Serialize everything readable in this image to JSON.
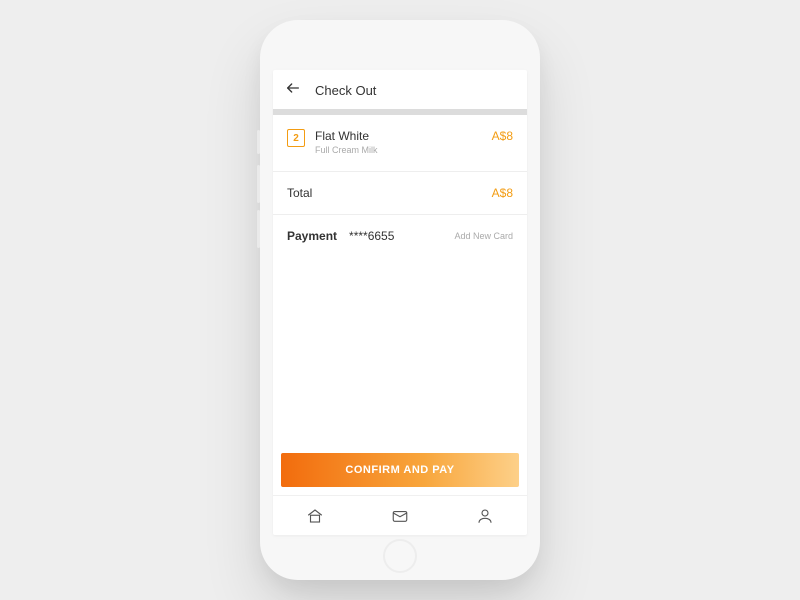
{
  "header": {
    "title": "Check Out"
  },
  "item": {
    "quantity": "2",
    "name": "Flat White",
    "subtitle": "Full Cream Milk",
    "price": "A$8"
  },
  "total": {
    "label": "Total",
    "price": "A$8"
  },
  "payment": {
    "label": "Payment",
    "card": "****6655",
    "add_card": "Add New Card"
  },
  "confirm_label": "CONFIRM AND PAY"
}
